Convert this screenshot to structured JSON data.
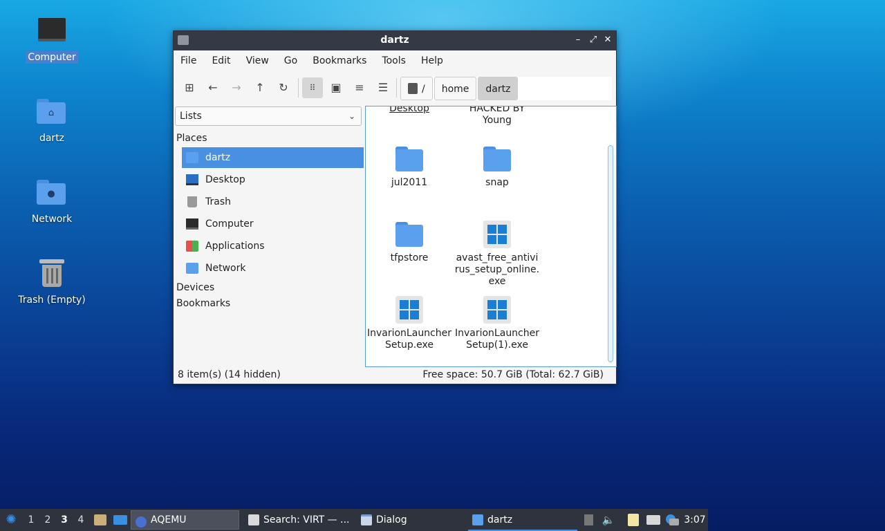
{
  "desktop": {
    "icons": [
      {
        "label": "Computer"
      },
      {
        "label": "dartz"
      },
      {
        "label": "Network"
      },
      {
        "label": "Trash (Empty)"
      }
    ]
  },
  "window": {
    "title": "dartz",
    "menu": [
      "File",
      "Edit",
      "View",
      "Go",
      "Bookmarks",
      "Tools",
      "Help"
    ],
    "path": [
      "/",
      "home",
      "dartz"
    ],
    "sidebar": {
      "select_value": "Lists",
      "places_label": "Places",
      "places": [
        "dartz",
        "Desktop",
        "Trash",
        "Computer",
        "Applications",
        "Network"
      ],
      "devices_label": "Devices",
      "bookmarks_label": "Bookmarks"
    },
    "files": [
      {
        "name": "Desktop",
        "kind": "folder"
      },
      {
        "name": "HACKED BY Young",
        "kind": "folder"
      },
      {
        "name": "jul2011",
        "kind": "folder"
      },
      {
        "name": "snap",
        "kind": "folder"
      },
      {
        "name": "tfpstore",
        "kind": "folder"
      },
      {
        "name": "avast_free_antivirus_setup_online.exe",
        "kind": "exe"
      },
      {
        "name": "InvarionLauncherSetup.exe",
        "kind": "exe"
      },
      {
        "name": "InvarionLauncherSetup(1).exe",
        "kind": "exe"
      }
    ],
    "status_left": "8 item(s) (14 hidden)",
    "status_right": "Free space: 50.7 GiB (Total: 62.7 GiB)"
  },
  "taskbar": {
    "workspaces": [
      "1",
      "2",
      "3",
      "4"
    ],
    "current_workspace": "3",
    "tasks": [
      "AQEMU",
      "Search: VIRT — ...",
      "Dialog",
      "dartz"
    ],
    "clock": "3:07"
  },
  "colors": {
    "accent": "#4a90e2",
    "titlebar": "#353945",
    "taskbar": "#2f333d"
  }
}
